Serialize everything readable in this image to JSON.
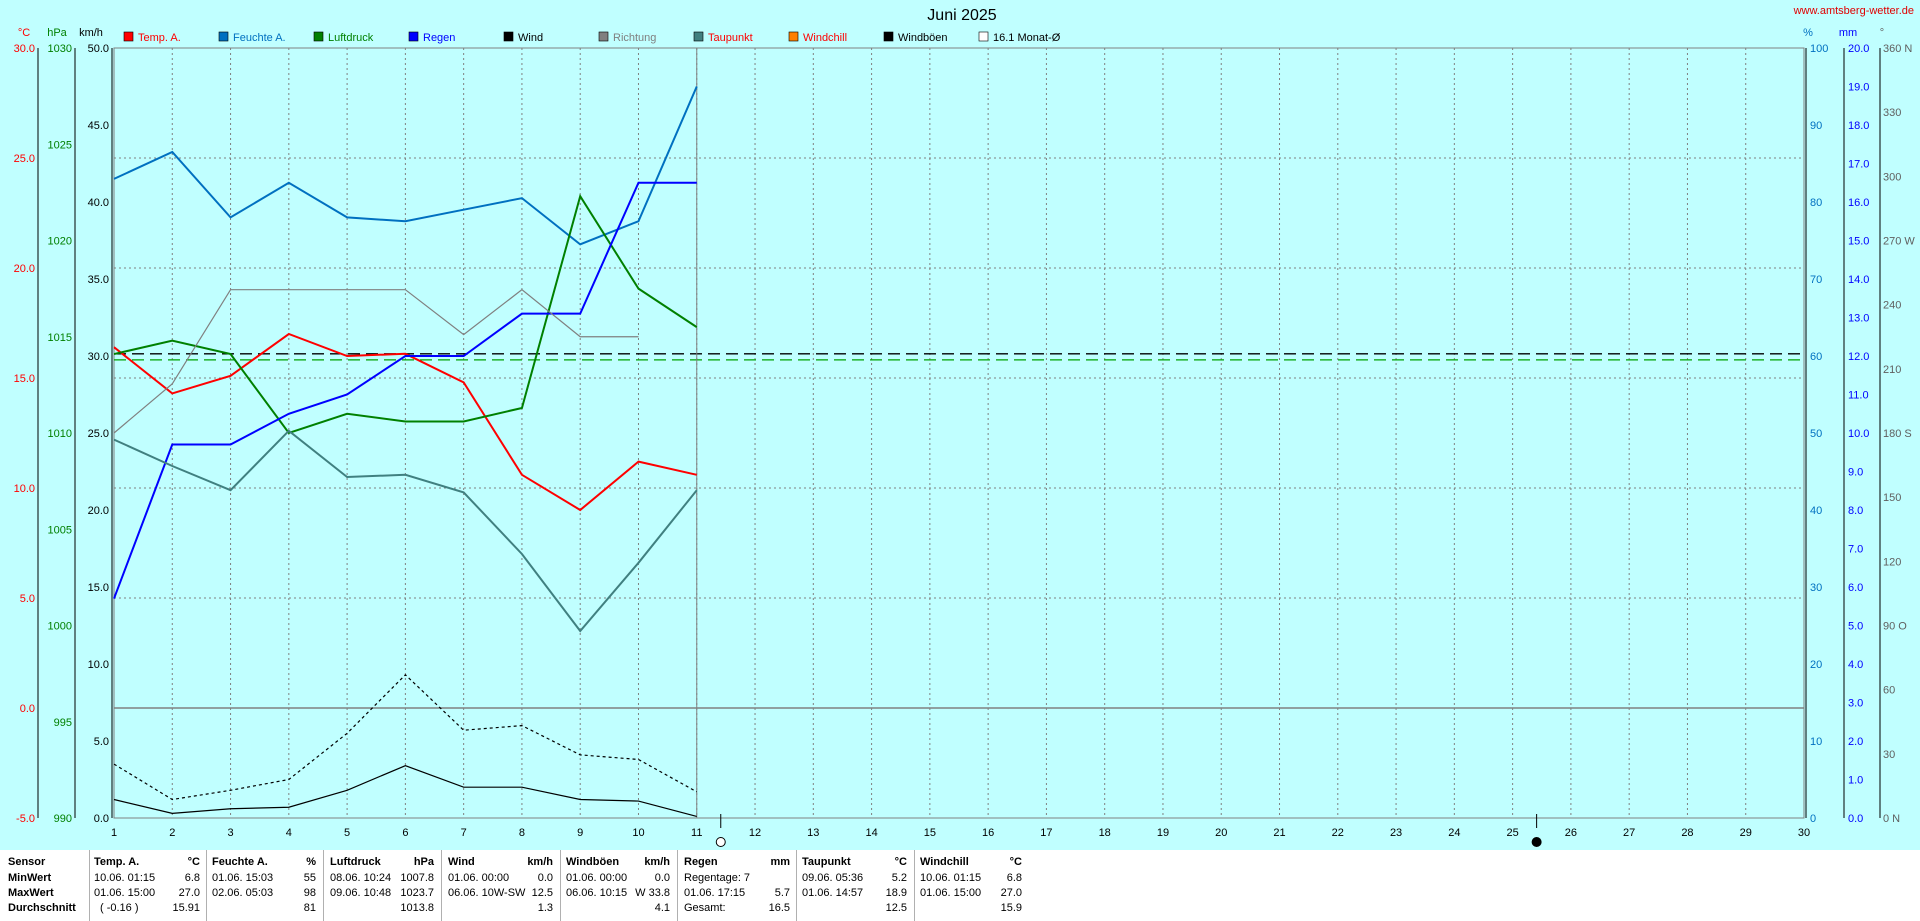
{
  "website": "www.amtsberg-wetter.de",
  "chart_data": {
    "type": "line",
    "title": "Juni 2025",
    "x": [
      1,
      2,
      3,
      4,
      5,
      6,
      7,
      8,
      9,
      10,
      11,
      12,
      13,
      14,
      15,
      16,
      17,
      18,
      19,
      20,
      21,
      22,
      23,
      24,
      25,
      26,
      27,
      28,
      29,
      30
    ],
    "xlim": [
      1,
      30
    ],
    "grid": true,
    "axes": {
      "celsius": {
        "unit": "°C",
        "range": [
          -5,
          30
        ],
        "ticks": [
          "30.0",
          "25.0",
          "20.0",
          "15.0",
          "10.0",
          "5.0",
          "0.0",
          "-5.0"
        ],
        "color": "#ff0000"
      },
      "hpa": {
        "unit": "hPa",
        "range": [
          990,
          1030
        ],
        "ticks": [
          "1030",
          "1025",
          "1020",
          "1015",
          "1010",
          "1005",
          "1000",
          "995",
          "990"
        ],
        "color": "#008000"
      },
      "kmh": {
        "unit": "km/h",
        "range": [
          0,
          50
        ],
        "ticks": [
          "50.0",
          "45.0",
          "40.0",
          "35.0",
          "30.0",
          "25.0",
          "20.0",
          "15.0",
          "10.0",
          "5.0",
          "0.0"
        ],
        "color": "#000000"
      },
      "percent": {
        "unit": "%",
        "range": [
          0,
          100
        ],
        "ticks": [
          "100",
          "90",
          "80",
          "70",
          "60",
          "50",
          "40",
          "30",
          "20",
          "10",
          "0"
        ],
        "color": "#0070c0"
      },
      "mm": {
        "unit": "mm",
        "range": [
          0,
          20
        ],
        "ticks": [
          "20.0",
          "19.0",
          "18.0",
          "17.0",
          "16.0",
          "15.0",
          "14.0",
          "13.0",
          "12.0",
          "11.0",
          "10.0",
          "9.0",
          "8.0",
          "7.0",
          "6.0",
          "5.0",
          "4.0",
          "3.0",
          "2.0",
          "1.0",
          "0.0"
        ],
        "color": "#0000ff"
      },
      "direction": {
        "unit": "°",
        "range": [
          0,
          360
        ],
        "ticks": [
          "360 N",
          "330",
          "300",
          "270 W",
          "240",
          "210",
          "180 S",
          "150",
          "120",
          "90 O",
          "60",
          "30",
          "0 N"
        ],
        "color": "#606060"
      }
    },
    "legend": [
      {
        "label": "Temp. A.",
        "color": "#ff0000",
        "text_color": "#ff0000"
      },
      {
        "label": "Feuchte A.",
        "color": "#0070c0",
        "text_color": "#0070c0"
      },
      {
        "label": "Luftdruck",
        "color": "#008000",
        "text_color": "#008000"
      },
      {
        "label": "Regen",
        "color": "#0000ff",
        "text_color": "#0000ff"
      },
      {
        "label": "Wind",
        "color": "#000000",
        "text_color": "#000000"
      },
      {
        "label": "Richtung",
        "color": "#808080",
        "text_color": "#808080"
      },
      {
        "label": "Taupunkt",
        "color": "#408080",
        "text_color": "#ff0000"
      },
      {
        "label": "Windchill",
        "color": "#ff8000",
        "text_color": "#ff0000"
      },
      {
        "label": "Windböen",
        "color": "#000000",
        "text_color": "#000000"
      },
      {
        "label": "16.1 Monat-Ø",
        "color": "#ffffff",
        "text_color": "#000000"
      }
    ],
    "series": [
      {
        "name": "Temp. A.",
        "axis": "celsius",
        "color": "#ff0000",
        "values": [
          16.4,
          14.3,
          15.1,
          17.0,
          16.0,
          16.1,
          14.8,
          10.6,
          9.0,
          11.2,
          10.6
        ]
      },
      {
        "name": "Feuchte A.",
        "axis": "percent",
        "color": "#0070c0",
        "values": [
          83,
          86.5,
          78,
          82.5,
          78,
          77.5,
          79,
          80.5,
          74.5,
          77.5,
          95
        ]
      },
      {
        "name": "Luftdruck",
        "axis": "hpa",
        "color": "#008000",
        "values": [
          1014.1,
          1014.8,
          1014.1,
          1010.0,
          1011.0,
          1010.6,
          1010.6,
          1011.3,
          1022.3,
          1017.5,
          1015.5
        ]
      },
      {
        "name": "Regen",
        "axis": "mm",
        "color": "#0000ff",
        "values": [
          5.7,
          9.7,
          9.7,
          10.5,
          11.0,
          12.0,
          12.0,
          13.1,
          13.1,
          16.5,
          16.5
        ]
      },
      {
        "name": "Richtung",
        "axis": "direction",
        "color": "#808080",
        "values": [
          180,
          203,
          247,
          247,
          247,
          247,
          226,
          247,
          225,
          225
        ]
      },
      {
        "name": "Taupunkt",
        "axis": "celsius",
        "color": "#408080",
        "values": [
          12.2,
          11.0,
          9.9,
          12.6,
          10.5,
          10.6,
          9.8,
          7.0,
          3.5,
          6.6,
          9.9
        ]
      },
      {
        "name": "Windböen",
        "axis": "kmh",
        "color": "#000000",
        "dashed": true,
        "values": [
          3.5,
          1.2,
          1.8,
          2.5,
          5.5,
          9.3,
          5.7,
          6.0,
          4.1,
          3.8,
          1.7
        ]
      },
      {
        "name": "Wind",
        "axis": "kmh",
        "color": "#000000",
        "values": [
          1.2,
          0.3,
          0.6,
          0.7,
          1.8,
          3.4,
          2.0,
          2.0,
          1.2,
          1.1,
          0.1
        ]
      }
    ],
    "reference_lines": [
      {
        "axis": "celsius",
        "value": 16.1,
        "color": "#000000",
        "dashed": true
      },
      {
        "axis": "hpa",
        "value": 1013.8,
        "color": "#00a000",
        "dashed": true
      },
      {
        "axis": "celsius",
        "value": 0.0,
        "color": "#808080",
        "dashed": false
      }
    ],
    "current_day": 11,
    "moon_phases": [
      {
        "day": 11,
        "phase": "full-moon"
      },
      {
        "day": 25,
        "phase": "new-moon"
      }
    ]
  },
  "stats": {
    "headers": {
      "sensor": "Sensor",
      "temp": "Temp. A.",
      "temp_unit": "°C",
      "feuchte": "Feuchte A.",
      "feuchte_unit": "%",
      "luftdruck": "Luftdruck",
      "luftdruck_unit": "hPa",
      "wind": "Wind",
      "wind_unit": "km/h",
      "windboeen": "Windböen",
      "windboeen_unit": "km/h",
      "regen": "Regen",
      "regen_unit": "mm",
      "taupunkt": "Taupunkt",
      "taupunkt_unit": "°C",
      "windchill": "Windchill",
      "windchill_unit": "°C"
    },
    "rows": [
      "MinWert",
      "MaxWert",
      "Durchschnitt"
    ],
    "temp": [
      {
        "time": "10.06.  01:15",
        "value": "6.8"
      },
      {
        "time": "01.06.  15:00",
        "value": "27.0"
      },
      {
        "time": "( -0.16 )",
        "value": "15.91"
      }
    ],
    "feuchte": [
      {
        "time": "01.06.  15:03",
        "value": "55"
      },
      {
        "time": "02.06.  05:03",
        "value": "98"
      },
      {
        "time": "",
        "value": "81"
      }
    ],
    "luftdruck": [
      {
        "time": "08.06.  10:24",
        "value": "1007.8"
      },
      {
        "time": "09.06.  10:48",
        "value": "1023.7"
      },
      {
        "time": "",
        "value": "1013.8"
      }
    ],
    "wind": [
      {
        "time": "01.06.  00:00",
        "value": "0.0"
      },
      {
        "time": "06.06.  10W-SW",
        "value": "12.5"
      },
      {
        "time": "",
        "value": "1.3"
      }
    ],
    "windboeen": [
      {
        "time": "01.06.  00:00",
        "value": "0.0"
      },
      {
        "time": "06.06.  10:15",
        "value": "W 33.8"
      },
      {
        "time": "",
        "value": "4.1"
      }
    ],
    "regen": [
      {
        "time": "Regentage: 7",
        "value": ""
      },
      {
        "time": "01.06.  17:15",
        "value": "5.7"
      },
      {
        "time": "Gesamt:",
        "value": "16.5"
      }
    ],
    "taupunkt": [
      {
        "time": "09.06.  05:36",
        "value": "5.2"
      },
      {
        "time": "01.06.  14:57",
        "value": "18.9"
      },
      {
        "time": "",
        "value": "12.5"
      }
    ],
    "windchill": [
      {
        "time": "10.06.  01:15",
        "value": "6.8"
      },
      {
        "time": "01.06.  15:00",
        "value": "27.0"
      },
      {
        "time": "",
        "value": "15.9"
      }
    ]
  }
}
